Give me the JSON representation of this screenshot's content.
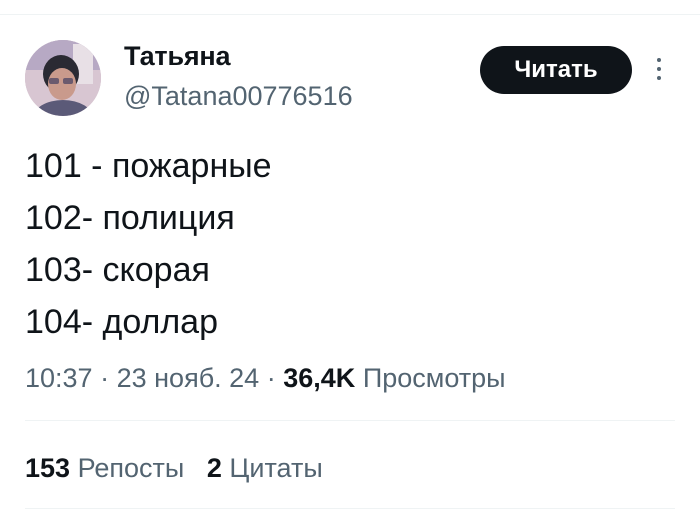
{
  "author": {
    "display_name": "Татьяна",
    "handle": "@Tatana00776516"
  },
  "follow_button": {
    "label": "Читать"
  },
  "more_button": {
    "icon": "more-vertical-icon"
  },
  "tweet": {
    "lines": [
      "101 - пожарные",
      "102- полиция",
      "103- скорая",
      "104- доллар"
    ],
    "time": "10:37",
    "separator": "·",
    "date": "23 нояб. 24",
    "views_count": "36,4K",
    "views_label": "Просмотры"
  },
  "stats": {
    "reposts_count": "153",
    "reposts_label": "Репосты",
    "quotes_count": "2",
    "quotes_label": "Цитаты"
  },
  "colors": {
    "text_primary": "#0f1419",
    "text_secondary": "#536471",
    "button_bg": "#0f1419",
    "button_text": "#ffffff",
    "divider": "#eff3f4"
  }
}
